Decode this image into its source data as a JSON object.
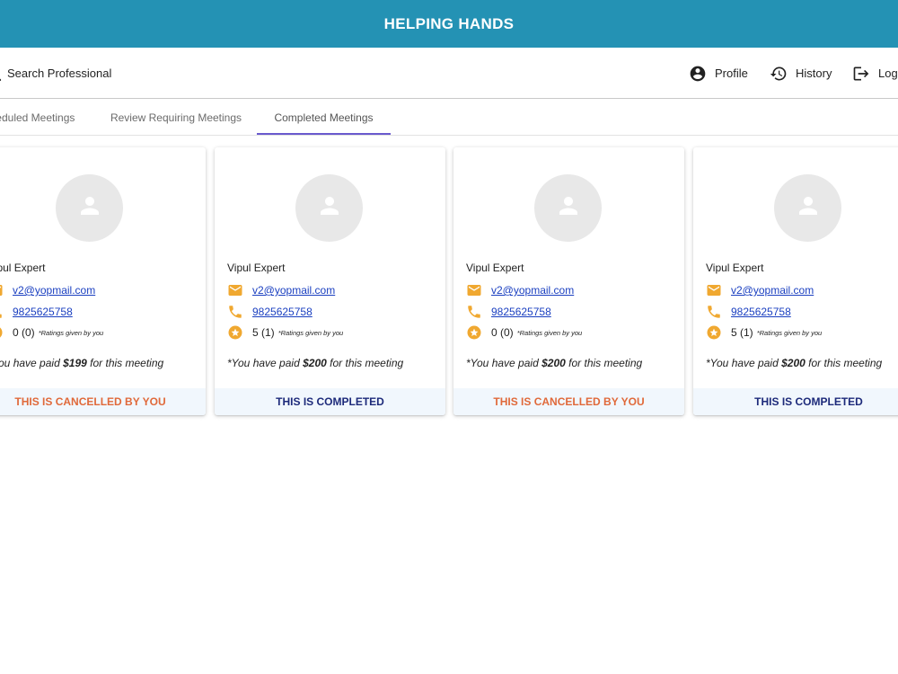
{
  "app": {
    "title": "HELPING HANDS"
  },
  "toolbar": {
    "search_label": "Search Professional",
    "profile_label": "Profile",
    "history_label": "History",
    "logout_label": "Logout"
  },
  "tabs": [
    {
      "label": "Scheduled Meetings"
    },
    {
      "label": "Review Requiring Meetings"
    },
    {
      "label": "Completed Meetings"
    }
  ],
  "active_tab": "Completed Meetings",
  "colors": {
    "appbar": "#2492b4",
    "icon_accent": "#f0a830",
    "link": "#1a3fc0",
    "tab_indicator": "#6a5acd",
    "status_cancelled": "#e0693a",
    "status_completed": "#1d2a7a"
  },
  "icons": {
    "search": "search-icon",
    "profile": "account-circle-icon",
    "history": "history-icon",
    "logout": "logout-icon",
    "avatar": "person-icon",
    "email": "mail-icon",
    "phone": "phone-icon",
    "rating": "star-icon"
  },
  "cards": [
    {
      "name": "Vipul Expert",
      "email": "v2@yopmail.com",
      "phone": "9825625758",
      "rating": "0 (0)",
      "rating_note": "*Ratings given by you",
      "paid_prefix": "*You have paid",
      "paid_amount": "$199",
      "paid_suffix": "for this meeting",
      "status": "THIS IS CANCELLED BY YOU",
      "status_type": "cancelled"
    },
    {
      "name": "Vipul Expert",
      "email": "v2@yopmail.com",
      "phone": "9825625758",
      "rating": "5 (1)",
      "rating_note": "*Ratings given by you",
      "paid_prefix": "*You have paid",
      "paid_amount": "$200",
      "paid_suffix": "for this meeting",
      "status": "THIS IS COMPLETED",
      "status_type": "completed"
    },
    {
      "name": "Vipul Expert",
      "email": "v2@yopmail.com",
      "phone": "9825625758",
      "rating": "0 (0)",
      "rating_note": "*Ratings given by you",
      "paid_prefix": "*You have paid",
      "paid_amount": "$200",
      "paid_suffix": "for this meeting",
      "status": "THIS IS CANCELLED BY YOU",
      "status_type": "cancelled"
    },
    {
      "name": "Vipul Expert",
      "email": "v2@yopmail.com",
      "phone": "9825625758",
      "rating": "5 (1)",
      "rating_note": "*Ratings given by you",
      "paid_prefix": "*You have paid",
      "paid_amount": "$200",
      "paid_suffix": "for this meeting",
      "status": "THIS IS COMPLETED",
      "status_type": "completed"
    }
  ]
}
